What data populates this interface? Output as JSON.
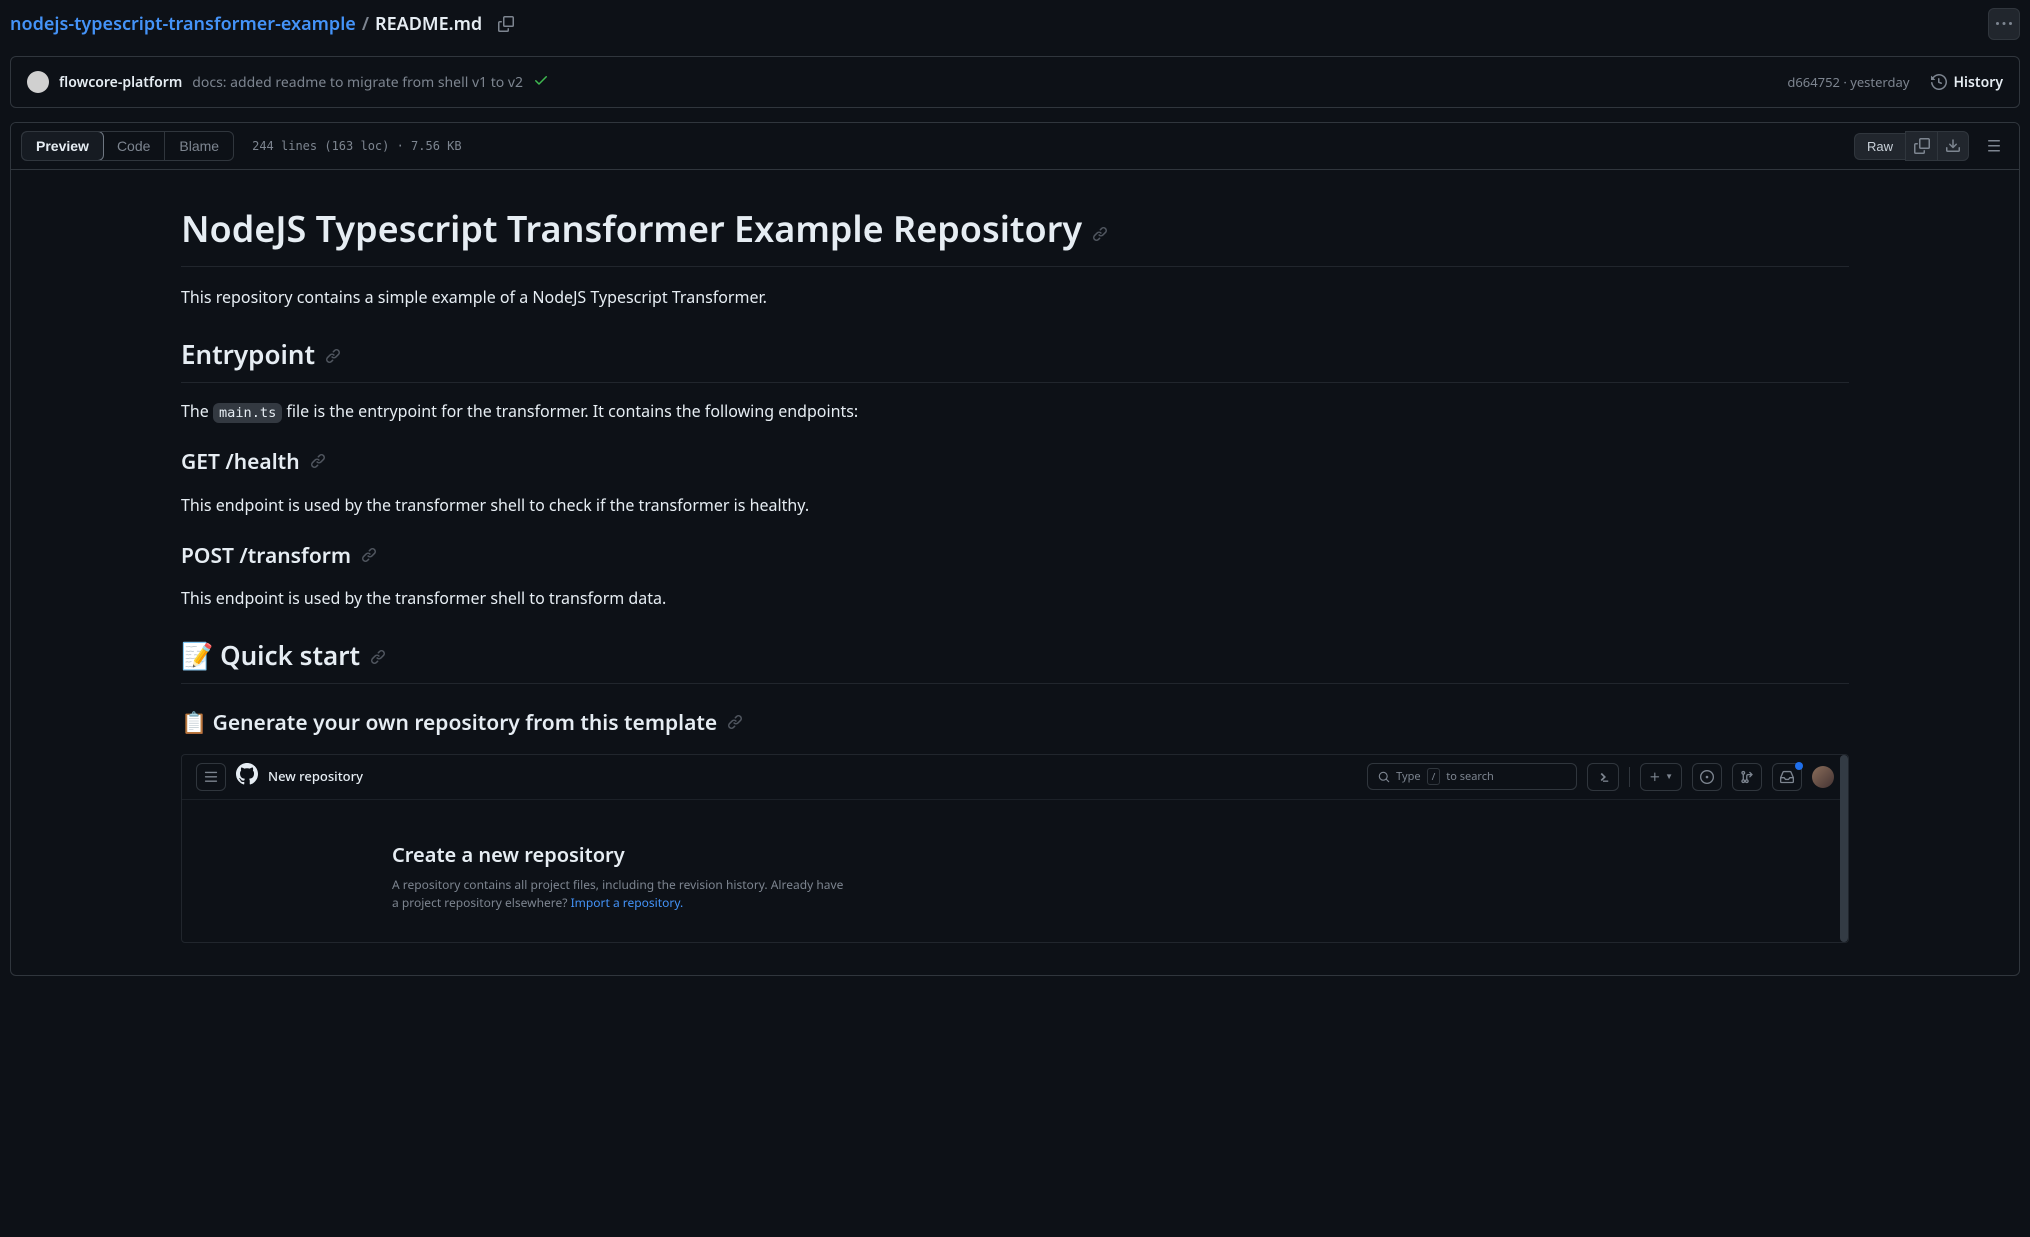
{
  "breadcrumb": {
    "repo": "nodejs-typescript-transformer-example",
    "separator": "/",
    "file": "README.md"
  },
  "commit": {
    "author": "flowcore-platform",
    "message": "docs: added readme to migrate from shell v1 to v2",
    "sha": "d664752",
    "time": "yesterday",
    "history_label": "History"
  },
  "tabs": {
    "preview": "Preview",
    "code": "Code",
    "blame": "Blame"
  },
  "file_stats": "244 lines (163 loc) · 7.56 KB",
  "actions": {
    "raw": "Raw"
  },
  "readme": {
    "h1": "NodeJS Typescript Transformer Example Repository",
    "intro": "This repository contains a simple example of a NodeJS Typescript Transformer.",
    "h2_entrypoint": "Entrypoint",
    "entrypoint_text_pre": "The ",
    "entrypoint_code": "main.ts",
    "entrypoint_text_post": " file is the entrypoint for the transformer. It contains the following endpoints:",
    "h3_health": "GET /health",
    "health_text": "This endpoint is used by the transformer shell to check if the transformer is healthy.",
    "h3_transform": "POST /transform",
    "transform_text": "This endpoint is used by the transformer shell to transform data.",
    "h2_quickstart": "📝 Quick start",
    "h3_generate": "📋 Generate your own repository from this template"
  },
  "screenshot": {
    "title": "New repository",
    "search_placeholder": "Type / to search",
    "heading": "Create a new repository",
    "subtext": "A repository contains all project files, including the revision history. Already have a project repository elsewhere? ",
    "import_link": "Import a repository."
  }
}
